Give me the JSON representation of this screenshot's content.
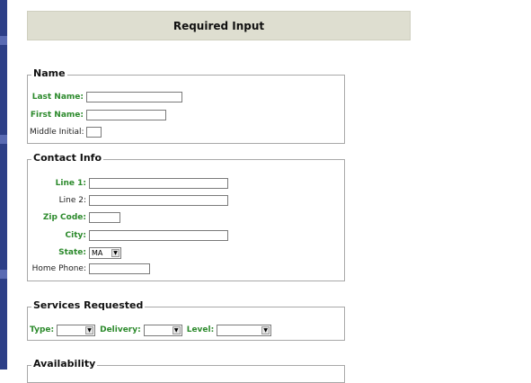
{
  "header": {
    "title": "Required Input"
  },
  "name_section": {
    "legend": "Name",
    "last_name": {
      "label": "Last Name:",
      "value": ""
    },
    "first_name": {
      "label": "First Name:",
      "value": ""
    },
    "middle_initial": {
      "label": "Middle Initial:",
      "value": ""
    }
  },
  "contact_section": {
    "legend": "Contact Info",
    "line1": {
      "label": "Line 1:",
      "value": ""
    },
    "line2": {
      "label": "Line 2:",
      "value": ""
    },
    "zip": {
      "label": "Zip Code:",
      "value": ""
    },
    "city": {
      "label": "City:",
      "value": ""
    },
    "state": {
      "label": "State:",
      "value": "MA"
    },
    "home_phone": {
      "label": "Home Phone:",
      "value": ""
    }
  },
  "services_section": {
    "legend": "Services Requested",
    "type": {
      "label": "Type:",
      "value": ""
    },
    "delivery": {
      "label": "Delivery:",
      "value": ""
    },
    "level": {
      "label": "Level:",
      "value": ""
    }
  },
  "availability_section": {
    "legend": "Availability"
  },
  "colors": {
    "required_label": "#2c8a2c",
    "header_bg": "#deded0",
    "left_bar": "#2d3f87"
  }
}
